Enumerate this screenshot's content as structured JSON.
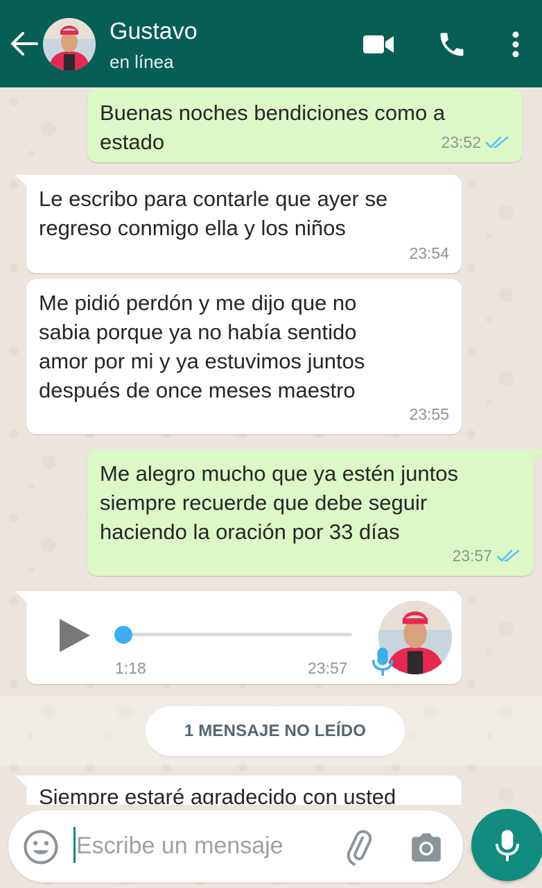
{
  "header": {
    "contact_name": "Gustavo",
    "status": "en línea",
    "color": "#075e54"
  },
  "messages": [
    {
      "direction": "out",
      "text": "Buenas noches bendiciones como a\nestado",
      "time": "23:52",
      "read": true
    },
    {
      "direction": "in",
      "text": "Le escribo para contarle que ayer se\nregreso conmigo ella y los niños",
      "time": "23:54"
    },
    {
      "direction": "in",
      "text": "Me pidió perdón y me dijo que no\nsabia porque ya no había sentido\namor por mi y ya estuvimos juntos\ndespués de once meses maestro",
      "time": "23:55"
    },
    {
      "direction": "out",
      "text": "Me alegro mucho que ya estén juntos\nsiempre recuerde que debe seguir\nhaciendo la oración por 33 días",
      "time": "23:57",
      "read": true
    }
  ],
  "voice_message": {
    "duration": "1:18",
    "time": "23:57",
    "progress": 0
  },
  "unread_divider": "1 MENSAJE NO LEÍDO",
  "partial_message": {
    "text": "Siempre estaré agradecido con usted"
  },
  "composer": {
    "placeholder": "Escribe un mensaje"
  },
  "icons": {
    "back": "arrow-left-icon",
    "video": "video-call-icon",
    "phone": "phone-icon",
    "menu": "more-vertical-icon",
    "emoji": "emoji-icon",
    "attach": "paperclip-icon",
    "camera": "camera-icon",
    "mic": "microphone-icon"
  },
  "colors": {
    "outgoing_bubble": "#dcf8c6",
    "incoming_bubble": "#ffffff",
    "read_ticks": "#4fc3f7",
    "accent": "#128c7e"
  }
}
